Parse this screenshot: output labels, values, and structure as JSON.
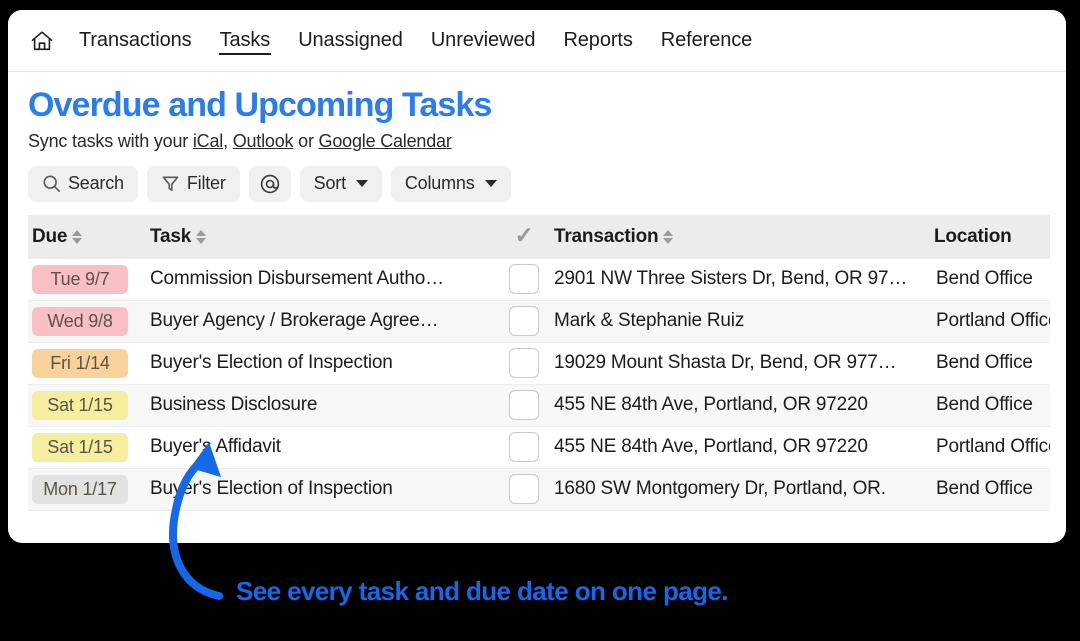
{
  "nav": {
    "home_icon": "home-icon",
    "items": [
      {
        "label": "Transactions",
        "active": false
      },
      {
        "label": "Tasks",
        "active": true
      },
      {
        "label": "Unassigned",
        "active": false
      },
      {
        "label": "Unreviewed",
        "active": false
      },
      {
        "label": "Reports",
        "active": false
      },
      {
        "label": "Reference",
        "active": false
      }
    ]
  },
  "page": {
    "title": "Overdue and Upcoming Tasks",
    "title_color": "#2b7cee",
    "sync": {
      "prefix": "Sync tasks with your ",
      "ical": "iCal",
      "comma": ", ",
      "outlook": "Outlook",
      "or": " or ",
      "google": "Google Calendar"
    }
  },
  "toolbar": {
    "search_label": "Search",
    "filter_label": "Filter",
    "mention_label": "@",
    "sort_label": "Sort",
    "columns_label": "Columns"
  },
  "table": {
    "headers": {
      "due": "Due",
      "task": "Task",
      "check": "✓",
      "transaction": "Transaction",
      "location": "Location"
    },
    "rows": [
      {
        "due": "Tue 9/7",
        "due_color": "#f9c0c4",
        "task": "Commission Disbursement Autho…",
        "checked": false,
        "transaction": "2901 NW Three Sisters Dr, Bend, OR 97…",
        "location": "Bend Office"
      },
      {
        "due": "Wed 9/8",
        "due_color": "#f9c0c4",
        "task": "Buyer Agency / Brokerage Agree…",
        "checked": false,
        "transaction": "Mark & Stephanie Ruiz",
        "location": "Portland Office"
      },
      {
        "due": "Fri 1/14",
        "due_color": "#f9d29b",
        "task": "Buyer's Election of Inspection",
        "checked": false,
        "transaction": "19029 Mount Shasta Dr, Bend, OR 977…",
        "location": "Bend Office"
      },
      {
        "due": "Sat 1/15",
        "due_color": "#f4ee9e",
        "task": "Business Disclosure",
        "checked": false,
        "transaction": "455 NE 84th Ave, Portland, OR 97220",
        "location": "Bend Office"
      },
      {
        "due": "Sat 1/15",
        "due_color": "#f4ee9e",
        "task": "Buyer's Affidavit",
        "checked": false,
        "transaction": "455 NE 84th Ave, Portland, OR 97220",
        "location": "Portland Office"
      },
      {
        "due": "Mon 1/17",
        "due_color": "#e2e2e2",
        "task": "Buyer's Election of Inspection",
        "checked": false,
        "transaction": "1680 SW Montgomery Dr, Portland, OR.",
        "location": "Bend Office"
      }
    ]
  },
  "annotation": {
    "callout": "See every task and due date on one page.",
    "arrow_color": "#1668ea",
    "text_color": "#1668ea"
  }
}
